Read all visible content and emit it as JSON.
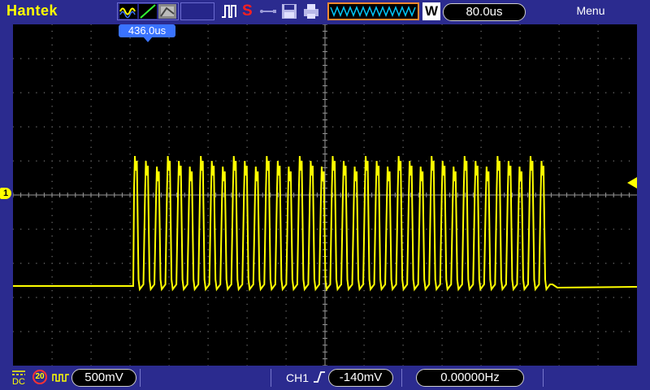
{
  "brand": "Hantek",
  "topbar": {
    "run_status": "S",
    "timebase_mode": "W",
    "timebase": "80.0us",
    "menu_label": "Menu"
  },
  "screen": {
    "trigger_position": "436.0us",
    "ch1_marker": "1"
  },
  "bottombar": {
    "ch1_coupling": "DC",
    "ch1_bw_limit": "20",
    "ch1_volts_div": "500mV",
    "trigger_source": "CH1",
    "trigger_level": "-140mV",
    "frequency": "0.00000Hz"
  },
  "colors": {
    "background": "#2b2b8f",
    "screen": "#000000",
    "ch1": "#ffff00",
    "grid": "#7a7a7a",
    "marker": "#3a73ff"
  }
}
